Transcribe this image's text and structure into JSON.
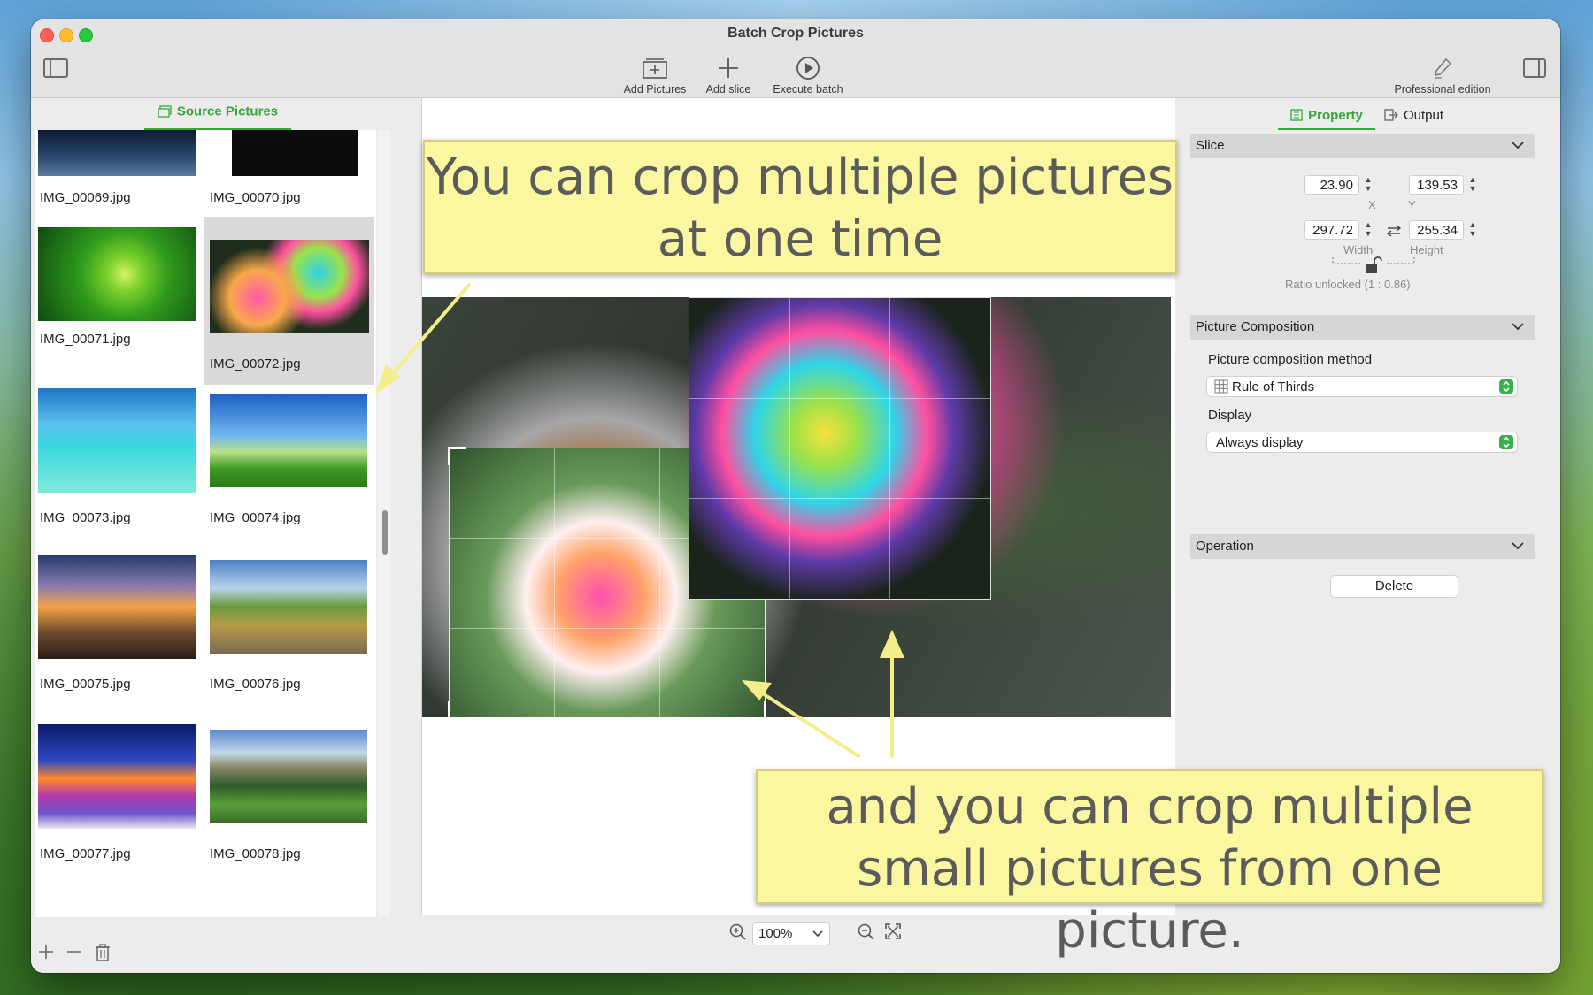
{
  "window": {
    "title": "Batch Crop Pictures"
  },
  "toolbar": {
    "add_pictures": "Add Pictures",
    "add_slice": "Add slice",
    "execute_batch": "Execute batch",
    "professional_edition": "Professional edition"
  },
  "left_panel": {
    "tab": "Source Pictures",
    "thumbnails": [
      {
        "name": "IMG_00069.jpg"
      },
      {
        "name": "IMG_00070.jpg"
      },
      {
        "name": "IMG_00071.jpg"
      },
      {
        "name": "IMG_00072.jpg",
        "selected": true
      },
      {
        "name": "IMG_00073.jpg"
      },
      {
        "name": "IMG_00074.jpg"
      },
      {
        "name": "IMG_00075.jpg"
      },
      {
        "name": "IMG_00076.jpg"
      },
      {
        "name": "IMG_00077.jpg"
      },
      {
        "name": "IMG_00078.jpg"
      }
    ],
    "footer_icons": [
      "plus-icon",
      "minus-icon",
      "trash-icon"
    ]
  },
  "canvas": {
    "zoom": "100%"
  },
  "right_panel": {
    "tabs": {
      "property": "Property",
      "output": "Output"
    },
    "slice": {
      "title": "Slice",
      "x": "23.90",
      "y": "139.53",
      "width": "297.72",
      "height": "255.34",
      "x_label": "X",
      "y_label": "Y",
      "width_label": "Width",
      "height_label": "Height",
      "ratio": "Ratio unlocked (1 : 0.86)"
    },
    "composition": {
      "title": "Picture Composition",
      "method_label": "Picture composition method",
      "method_value": "Rule of Thirds",
      "display_label": "Display",
      "display_value": "Always display"
    },
    "operation": {
      "title": "Operation",
      "delete": "Delete"
    }
  },
  "callouts": {
    "top_line1": "You can crop multiple pictures",
    "top_line2": "at one time",
    "bottom_line1": "and you can crop multiple",
    "bottom_line2": "small pictures from one picture."
  },
  "colors": {
    "accent_green": "#35a83a",
    "callout_yellow": "#fbf6a0",
    "arrow_yellow": "#f3ee8a"
  }
}
